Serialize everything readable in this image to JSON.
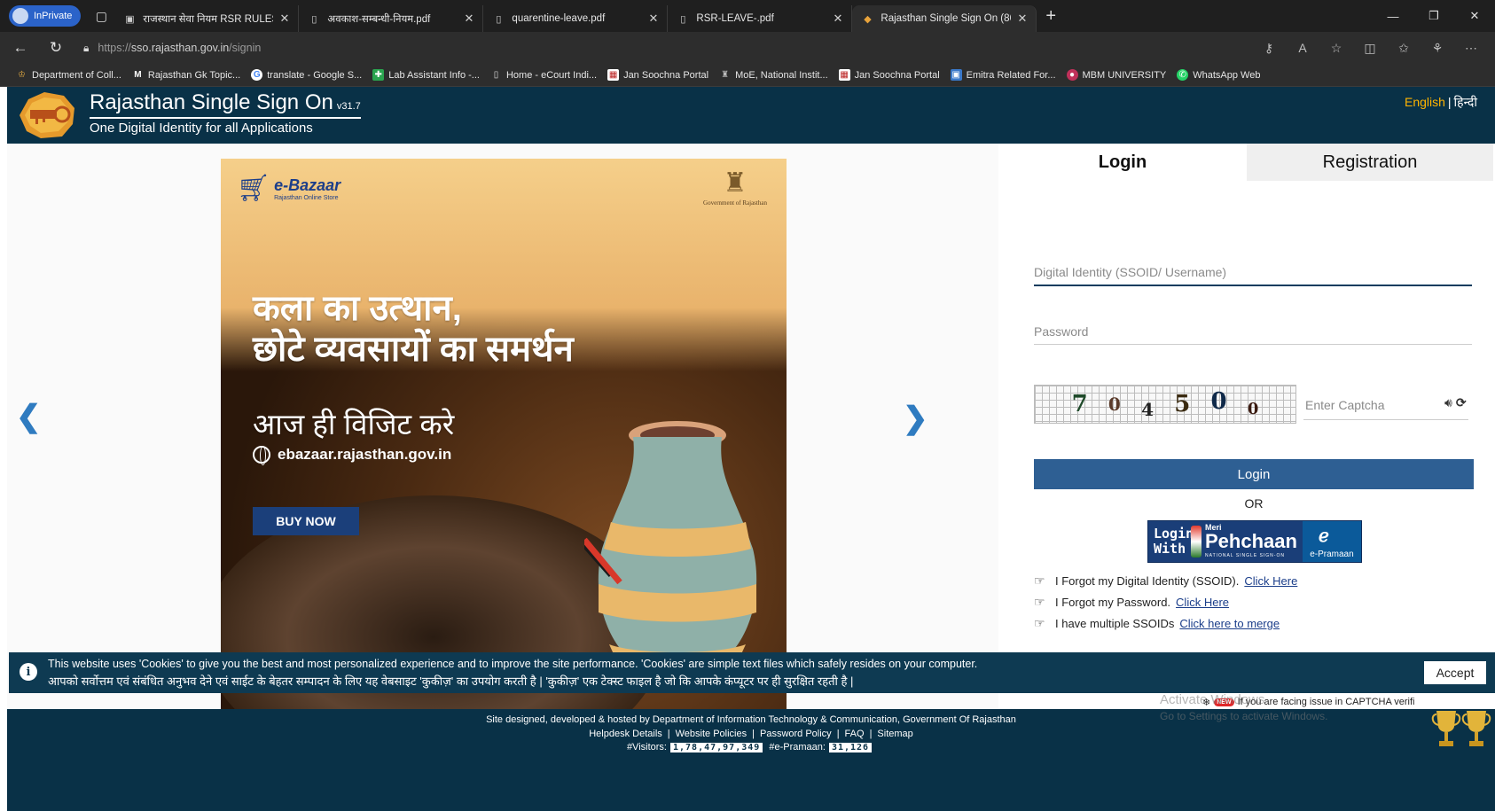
{
  "browser": {
    "inprivate_label": "InPrivate",
    "tabs": [
      {
        "label": "राजस्थान सेवा नियम RSR RULES • R",
        "icon": "document-icon"
      },
      {
        "label": "अवकाश-सम्बन्धी-नियम.pdf",
        "icon": "pdf-icon"
      },
      {
        "label": "quarentine-leave.pdf",
        "icon": "pdf-icon"
      },
      {
        "label": "RSR-LEAVE-.pdf",
        "icon": "pdf-icon"
      },
      {
        "label": "Rajasthan Single Sign On (86)",
        "icon": "site-icon",
        "active": true
      }
    ],
    "url_scheme": "https://",
    "url_host": "sso.rajasthan.gov.in",
    "url_path": "/signin",
    "bookmarks": [
      "Department of Coll...",
      "Rajasthan Gk Topic...",
      "translate - Google S...",
      "Lab Assistant Info -...",
      "Home - eCourt Indi...",
      "Jan Soochna Portal",
      "MoE, National Instit...",
      "Jan Soochna Portal",
      "Emitra Related For...",
      "MBM UNIVERSITY",
      "WhatsApp Web"
    ]
  },
  "header": {
    "title": "Rajasthan Single Sign On",
    "version": "v31.7",
    "subtitle": "One Digital Identity for all Applications",
    "lang_en": "English",
    "lang_sep": "|",
    "lang_hi": "हिन्दी"
  },
  "banner": {
    "brand": "e-Bazaar",
    "brand_tag": "Rajasthan Online Store",
    "gov_label": "Government of Rajasthan",
    "headline_line1": "कला का उत्थान,",
    "headline_line2": "छोटे व्यवसायों का समर्थन",
    "visit": "आज ही विजिट करे",
    "website": "ebazaar.rajasthan.gov.in",
    "cta": "BUY NOW"
  },
  "login": {
    "tab_login": "Login",
    "tab_registration": "Registration",
    "ssoid_placeholder": "Digital Identity (SSOID/ Username)",
    "password_placeholder": "Password",
    "captcha_digits": [
      "7",
      "0",
      "4",
      "5",
      "0",
      "0"
    ],
    "captcha_placeholder": "Enter Captcha",
    "login_button": "Login",
    "or": "OR",
    "mp_login_with": "Login With",
    "mp_meri": "Meri",
    "mp_pehchaan": "Pehchaan",
    "mp_national": "NATIONAL SINGLE SIGN-ON",
    "mp_epramaan": "e-Pramaan",
    "help": [
      {
        "text": "I Forgot my Digital Identity (SSOID).",
        "link": "Click Here"
      },
      {
        "text": "I Forgot my Password.",
        "link": "Click Here"
      },
      {
        "text": "I have multiple SSOIDs",
        "link": "Click here to merge"
      }
    ]
  },
  "cookie": {
    "text_en": "This website uses 'Cookies' to give you the best and most personalized experience and to improve the site performance. 'Cookies' are simple text files which safely resides on your computer.",
    "text_hi": "आपको सर्वोत्तम एवं संबंधित अनुभव देने एवं साईट के बेहतर सम्पादन के लिए यह वेबसाइट 'कुकीज़' का उपयोग करती है | 'कुकीज़' एक टेक्स्ट फाइल है जो कि आपके कंप्यूटर पर ही सुरक्षित रहती है |",
    "accept": "Accept"
  },
  "captcha_notice": {
    "badge": "NEW",
    "text": "If you are facing issue in CAPTCHA verifi"
  },
  "watermark": {
    "line1": "Activate Windows",
    "line2": "Go to Settings to activate Windows."
  },
  "footer": {
    "designed": "Site designed, developed & hosted by Department of Information Technology & Communication, Government Of Rajasthan",
    "links": [
      "Helpdesk Details",
      "Website Policies",
      "Password Policy",
      "FAQ",
      "Sitemap"
    ],
    "visitors_label": "#Visitors:",
    "visitors_value": "1,78,47,97,349",
    "epramaan_label": "#e-Pramaan:",
    "epramaan_value": "31,126"
  }
}
